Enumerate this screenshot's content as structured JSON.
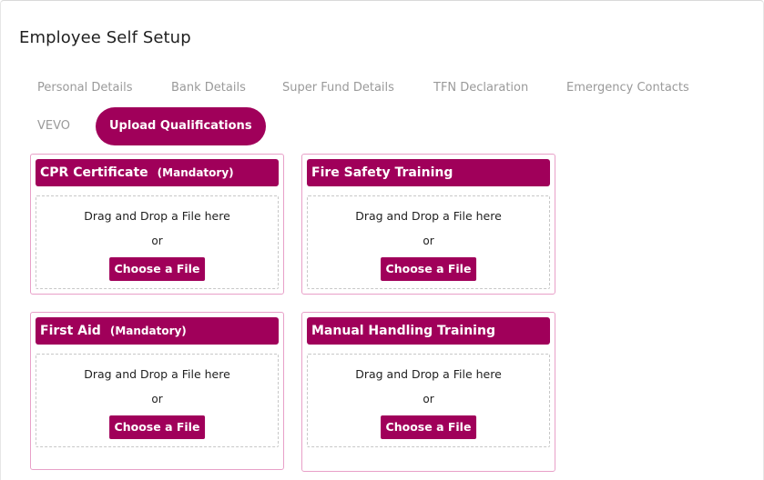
{
  "page": {
    "title": "Employee Self Setup"
  },
  "tabs": [
    {
      "label": "Personal Details",
      "active": false
    },
    {
      "label": "Bank Details",
      "active": false
    },
    {
      "label": "Super Fund Details",
      "active": false
    },
    {
      "label": "TFN Declaration",
      "active": false
    },
    {
      "label": "Emergency Contacts",
      "active": false
    },
    {
      "label": "VEVO",
      "active": false
    },
    {
      "label": "Upload Qualifications",
      "active": true
    }
  ],
  "qualifications": [
    {
      "title": "CPR Certificate",
      "badge": "(Mandatory)",
      "drop_text": "Drag and Drop a File here",
      "or_text": "or",
      "button_label": "Choose a File"
    },
    {
      "title": "Fire Safety Training",
      "badge": "",
      "drop_text": "Drag and Drop a File here",
      "or_text": "or",
      "button_label": "Choose a File"
    },
    {
      "title": "First Aid",
      "badge": "(Mandatory)",
      "drop_text": "Drag and Drop a File here",
      "or_text": "or",
      "button_label": "Choose a File"
    },
    {
      "title": "Manual Handling Training",
      "badge": "",
      "drop_text": "Drag and Drop a File here",
      "or_text": "or",
      "button_label": "Choose a File"
    }
  ],
  "colors": {
    "accent": "#a0005a",
    "card_border": "#e8a0c8",
    "tab_inactive": "#9a9a9a"
  }
}
